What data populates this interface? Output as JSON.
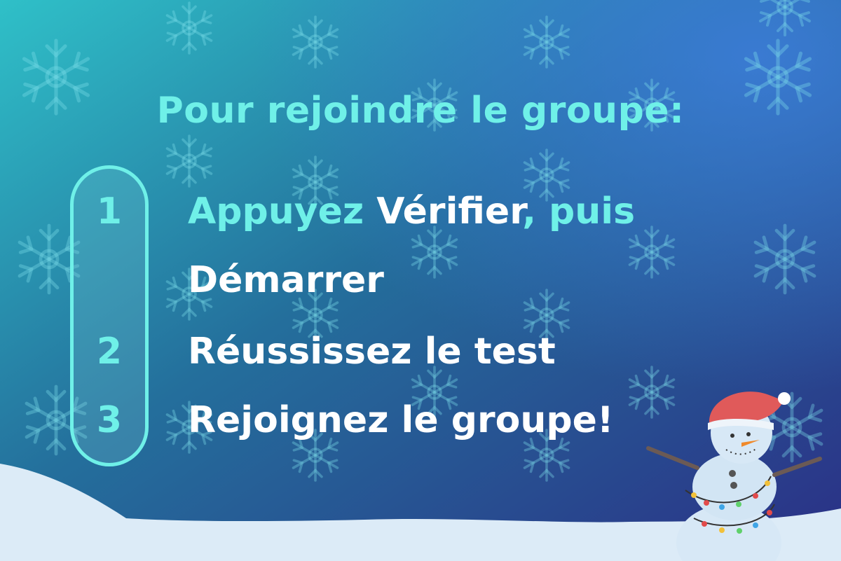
{
  "colors": {
    "title": "#6ff0e8",
    "accent": "#6ff0e8",
    "white": "#ffffff",
    "bg_top_left": "#2fb8c6",
    "bg_bottom_right": "#2a3a8a",
    "snow": "#dcebf7"
  },
  "title": "Pour rejoindre le groupe:",
  "steps": [
    {
      "number": "1",
      "line1_a": "Appuyez ",
      "line1_b": "Vérifier",
      "line1_c": ", puis",
      "line2": "Démarrer"
    },
    {
      "number": "2",
      "text": "Réussissez le test"
    },
    {
      "number": "3",
      "text": "Rejoignez le groupe!"
    }
  ],
  "decorations": [
    "snowflake-icons",
    "snowman-icon",
    "snow-hill"
  ]
}
